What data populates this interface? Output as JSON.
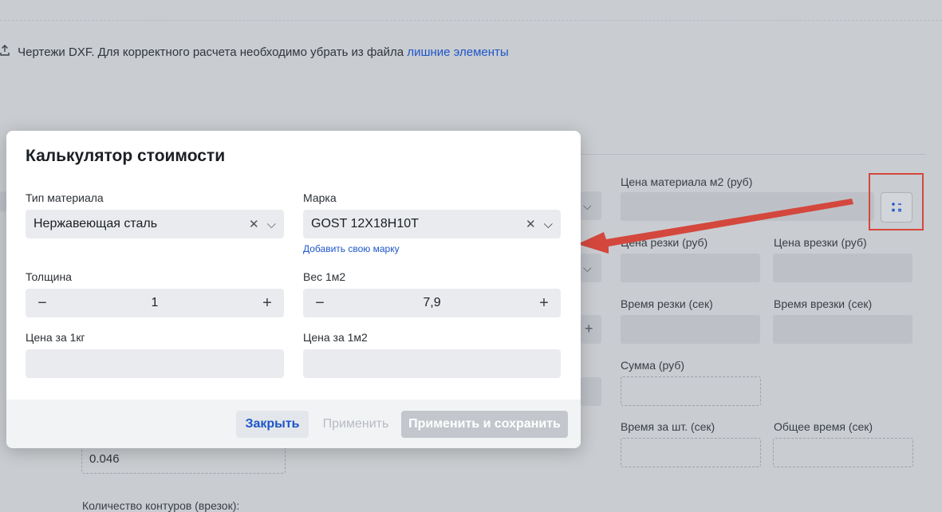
{
  "background": {
    "dxf_text": "Чертежи DXF. Для корректного расчета необходимо убрать из файла",
    "dxf_link": "лишние элементы",
    "fields": {
      "material_price_label": "Цена материала м2 (руб)",
      "cut_price_label": "Цена резки (руб)",
      "pierce_price_label": "Цена врезки (руб)",
      "cut_time_label": "Время резки (сек)",
      "pierce_time_label": "Время врезки (сек)",
      "sum_label": "Сумма (руб)",
      "time_per_piece_label": "Время за шт. (сек)",
      "total_time_label": "Общее время (сек)",
      "left_value": "0.046",
      "contours_label": "Количество контуров (врезок):"
    }
  },
  "modal": {
    "title": "Калькулятор стоимости",
    "material_type_label": "Тип материала",
    "material_type_value": "Нержавеющая сталь",
    "grade_label": "Марка",
    "grade_value": "GOST 12X18H10T",
    "add_grade_link": "Добавить свою марку",
    "thickness_label": "Толщина",
    "thickness_value": "1",
    "weight_label": "Вес 1м2",
    "weight_value": "7,9",
    "price_kg_label": "Цена за 1кг",
    "price_m2_label": "Цена за 1м2",
    "buttons": {
      "close": "Закрыть",
      "apply": "Применить",
      "apply_save": "Применить и сохранить"
    }
  },
  "colors": {
    "accent_link": "#1d56c9",
    "annotation_red": "#d4473d"
  }
}
